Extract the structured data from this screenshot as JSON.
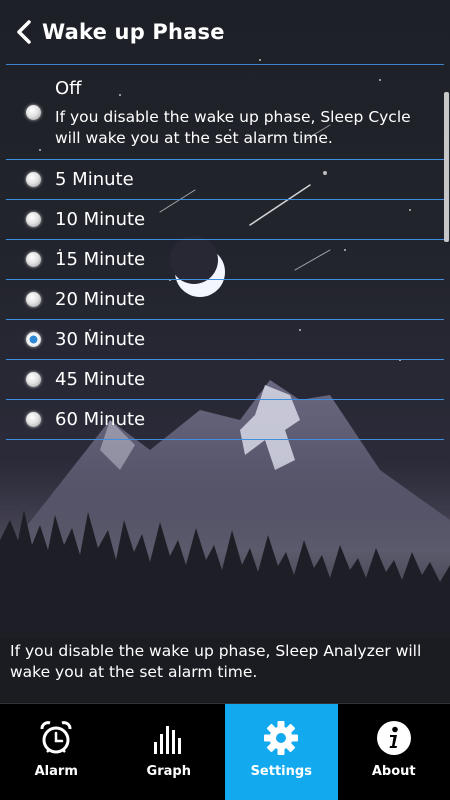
{
  "header": {
    "title": "Wake up Phase"
  },
  "options": {
    "off": {
      "title": "Off",
      "description": "If you disable the wake up phase, Sleep Cycle will wake you at the set alarm time."
    },
    "items": [
      {
        "label": "5 Minute",
        "checked": false
      },
      {
        "label": "10 Minute",
        "checked": false
      },
      {
        "label": "15 Minute",
        "checked": false
      },
      {
        "label": "20 Minute",
        "checked": false
      },
      {
        "label": "30 Minute",
        "checked": true
      },
      {
        "label": "45 Minute",
        "checked": false
      },
      {
        "label": "60 Minute",
        "checked": false
      }
    ]
  },
  "footer_note": "If you disable the wake up phase, Sleep Analyzer will wake you at the set alarm time.",
  "tabs": [
    {
      "label": "Alarm",
      "icon": "alarm-clock-icon",
      "active": false
    },
    {
      "label": "Graph",
      "icon": "bar-graph-icon",
      "active": false
    },
    {
      "label": "Settings",
      "icon": "gear-icon",
      "active": true
    },
    {
      "label": "About",
      "icon": "info-icon",
      "active": false
    }
  ],
  "colors": {
    "accent": "#13a9ee",
    "divider": "#3e8fe0",
    "selected_radio": "#2f88d6",
    "tabbar_bg": "#000000"
  }
}
